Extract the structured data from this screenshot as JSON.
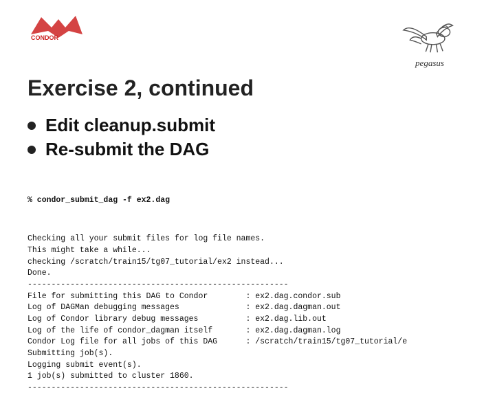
{
  "header": {
    "title": "Exercise 2, continued"
  },
  "bullets": [
    {
      "label": "Edit cleanup.submit"
    },
    {
      "label": "Re-submit the DAG"
    }
  ],
  "pegasus_text": "pegasus",
  "code": {
    "command": "% condor_submit_dag -f ex2.dag",
    "lines": [
      "Checking all your submit files for log file names.",
      "This might take a while...",
      "checking /scratch/train15/tg07_tutorial/ex2 instead...",
      "Done.",
      "-------------------------------------------------------",
      "File for submitting this DAG to Condor        : ex2.dag.condor.sub",
      "Log of DAGMan debugging messages              : ex2.dag.dagman.out",
      "Log of Condor library debug messages          : ex2.dag.lib.out",
      "Log of the life of condor_dagman itself       : ex2.dag.dagman.log",
      "",
      "Condor Log file for all jobs of this DAG      : /scratch/train15/tg07_tutorial/e",
      "Submitting job(s).",
      "Logging submit event(s).",
      "1 job(s) submitted to cluster 1860.",
      "-------------------------------------------------------"
    ]
  }
}
